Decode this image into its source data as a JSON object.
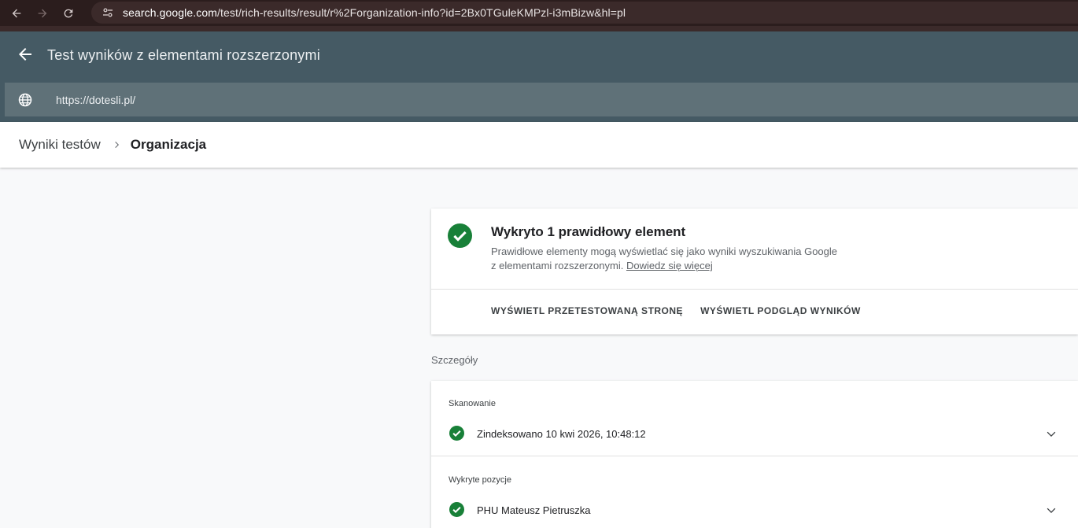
{
  "browser": {
    "url_host": "search.google.com",
    "url_path": "/test/rich-results/result/r%2Forganization-info?id=2Bx0TGuleKMPzl-i3mBizw&hl=pl"
  },
  "header": {
    "title": "Test wyników z elementami rozszerzonymi",
    "tested_url": "https://dotesli.pl/"
  },
  "breadcrumb": {
    "parent": "Wyniki testów",
    "current": "Organizacja"
  },
  "result_card": {
    "headline": "Wykryto 1 prawidłowy element",
    "description_line1": "Prawidłowe elementy mogą wyświetlać się jako wyniki wyszukiwania Google",
    "description_line2": "z elementami rozszerzonymi.",
    "learn_more": "Dowiedz się więcej",
    "action_tested_page": "WYŚWIETL PRZETESTOWANĄ STRONĘ",
    "action_preview": "WYŚWIETL PODGLĄD WYNIKÓW"
  },
  "details": {
    "section_title": "Szczegóły",
    "crawl": {
      "title": "Skanowanie",
      "status": "Zindeksowano 10 kwi 2026, 10:48:12"
    },
    "detected": {
      "title": "Wykryte pozycje",
      "item": "PHU Mateusz Pietruszka"
    }
  },
  "colors": {
    "success": "#188038",
    "header_bg": "#455a64",
    "chrome_bg": "#2b1d1d"
  }
}
